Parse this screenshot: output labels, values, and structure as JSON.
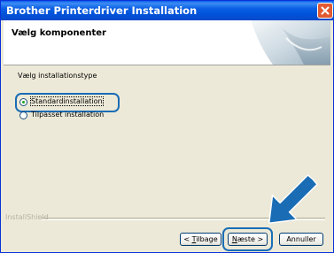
{
  "window": {
    "title": "Brother Printerdriver Installation",
    "close_icon": "close-icon"
  },
  "header": {
    "title": "Vælg komponenter",
    "graphic_icon": "wizard-header-graphic"
  },
  "main": {
    "section_label": "Vælg installationstype",
    "options": [
      {
        "label": "Standardinstallation",
        "selected": true
      },
      {
        "label": "Tilpasset installation",
        "selected": false
      }
    ]
  },
  "footer": {
    "brand": "InstallShield",
    "buttons": {
      "back": {
        "prefix": "< ",
        "mnemonic": "T",
        "rest": "ilbage"
      },
      "next": {
        "mnemonic": "N",
        "rest": "æste",
        "suffix": " >"
      },
      "cancel": {
        "label": "Annuller"
      }
    }
  },
  "annotations": {
    "highlight_color": "#1a6db5",
    "arrow_icon": "pointer-arrow-icon"
  }
}
